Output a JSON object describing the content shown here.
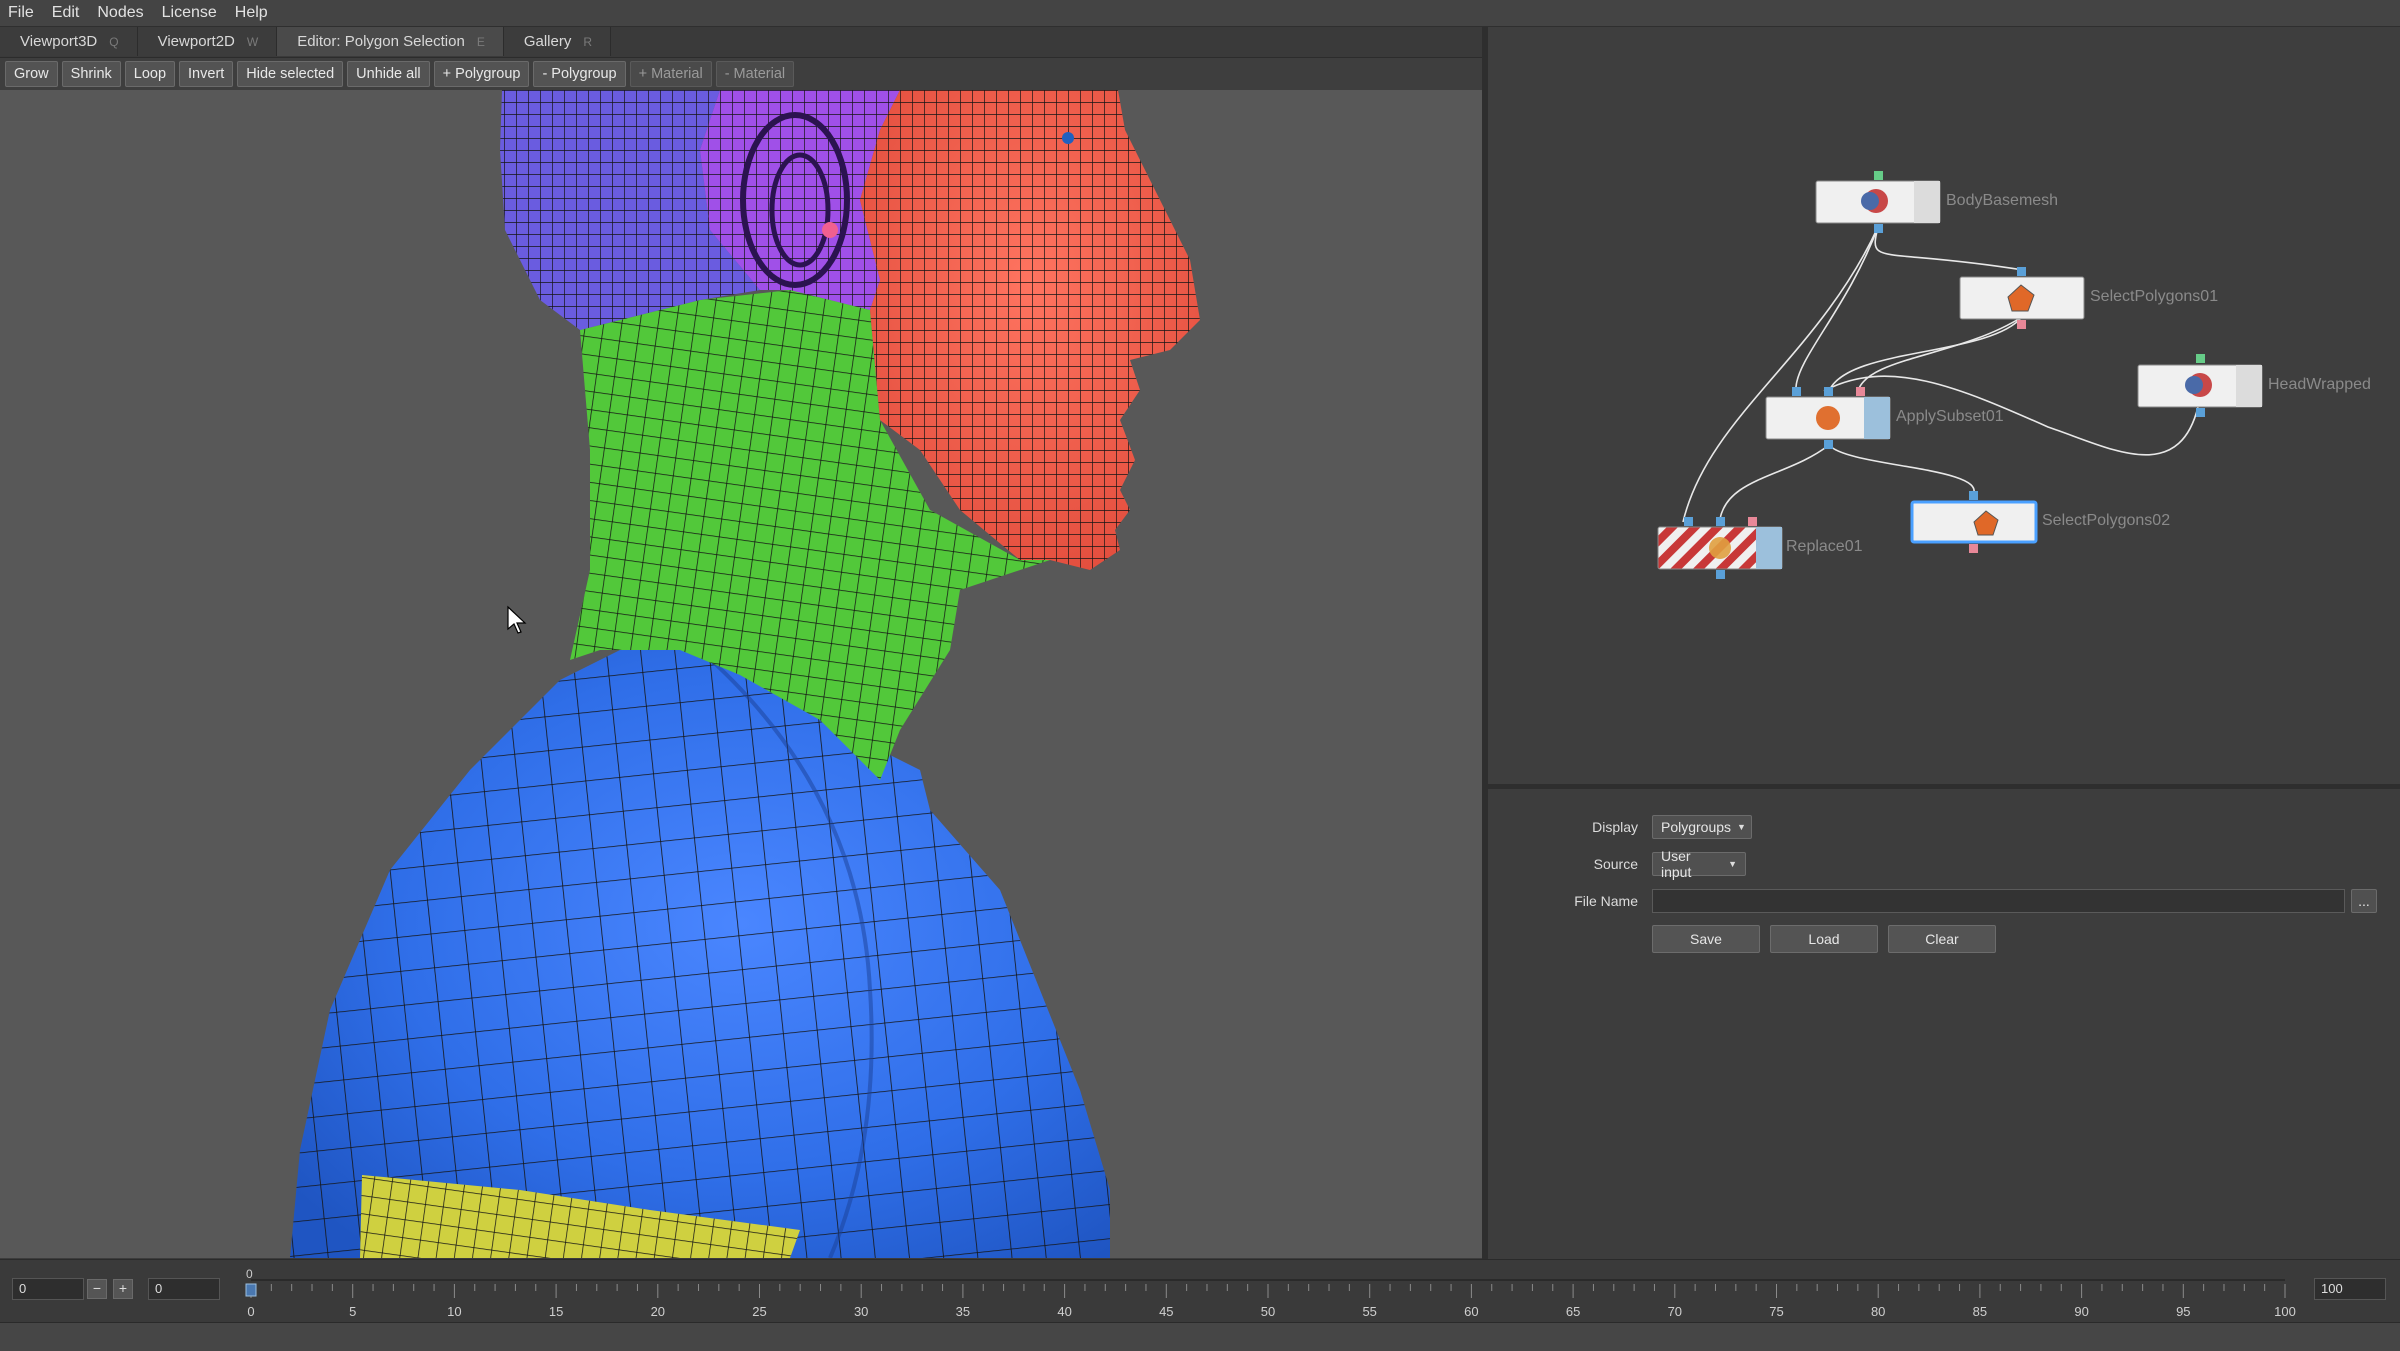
{
  "menu": [
    "File",
    "Edit",
    "Nodes",
    "License",
    "Help"
  ],
  "tabs": [
    {
      "label": "Viewport3D",
      "hotkey": "Q"
    },
    {
      "label": "Viewport2D",
      "hotkey": "W"
    },
    {
      "label": "Editor: Polygon Selection",
      "hotkey": "E"
    },
    {
      "label": "Gallery",
      "hotkey": "R"
    }
  ],
  "toolbar": [
    "Grow",
    "Shrink",
    "Loop",
    "Invert",
    "Hide selected",
    "Unhide all",
    "+ Polygroup",
    "- Polygroup",
    "+ Material",
    "- Material"
  ],
  "nodes": {
    "body_basemesh": "BodyBasemesh",
    "select_polygons_01": "SelectPolygons01",
    "head_wrapped": "HeadWrapped",
    "apply_subset_01": "ApplySubset01",
    "select_polygons_02": "SelectPolygons02",
    "replace_01": "Replace01"
  },
  "properties": {
    "display_label": "Display",
    "display_value": "Polygroups",
    "source_label": "Source",
    "source_value": "User input",
    "filename_label": "File Name",
    "filename_value": "",
    "browse": "...",
    "save": "Save",
    "load": "Load",
    "clear": "Clear"
  },
  "timeline": {
    "start": "0",
    "current": "0",
    "end": "100",
    "minus": "−",
    "plus": "+",
    "playhead": "0",
    "ticks": [
      "0",
      "5",
      "10",
      "15",
      "20",
      "25",
      "30",
      "35",
      "40",
      "45",
      "50",
      "55",
      "60",
      "65",
      "70",
      "75",
      "80",
      "85",
      "90",
      "95",
      "100"
    ]
  },
  "colors": {
    "polygroup_purple": "#6a5ce0",
    "polygroup_violet": "#a050e8",
    "polygroup_red": "#f05a48",
    "polygroup_green": "#52c83a",
    "polygroup_blue": "#2f6ee8",
    "polygroup_yellow": "#cfd040",
    "viewport_bg": "#585858"
  }
}
